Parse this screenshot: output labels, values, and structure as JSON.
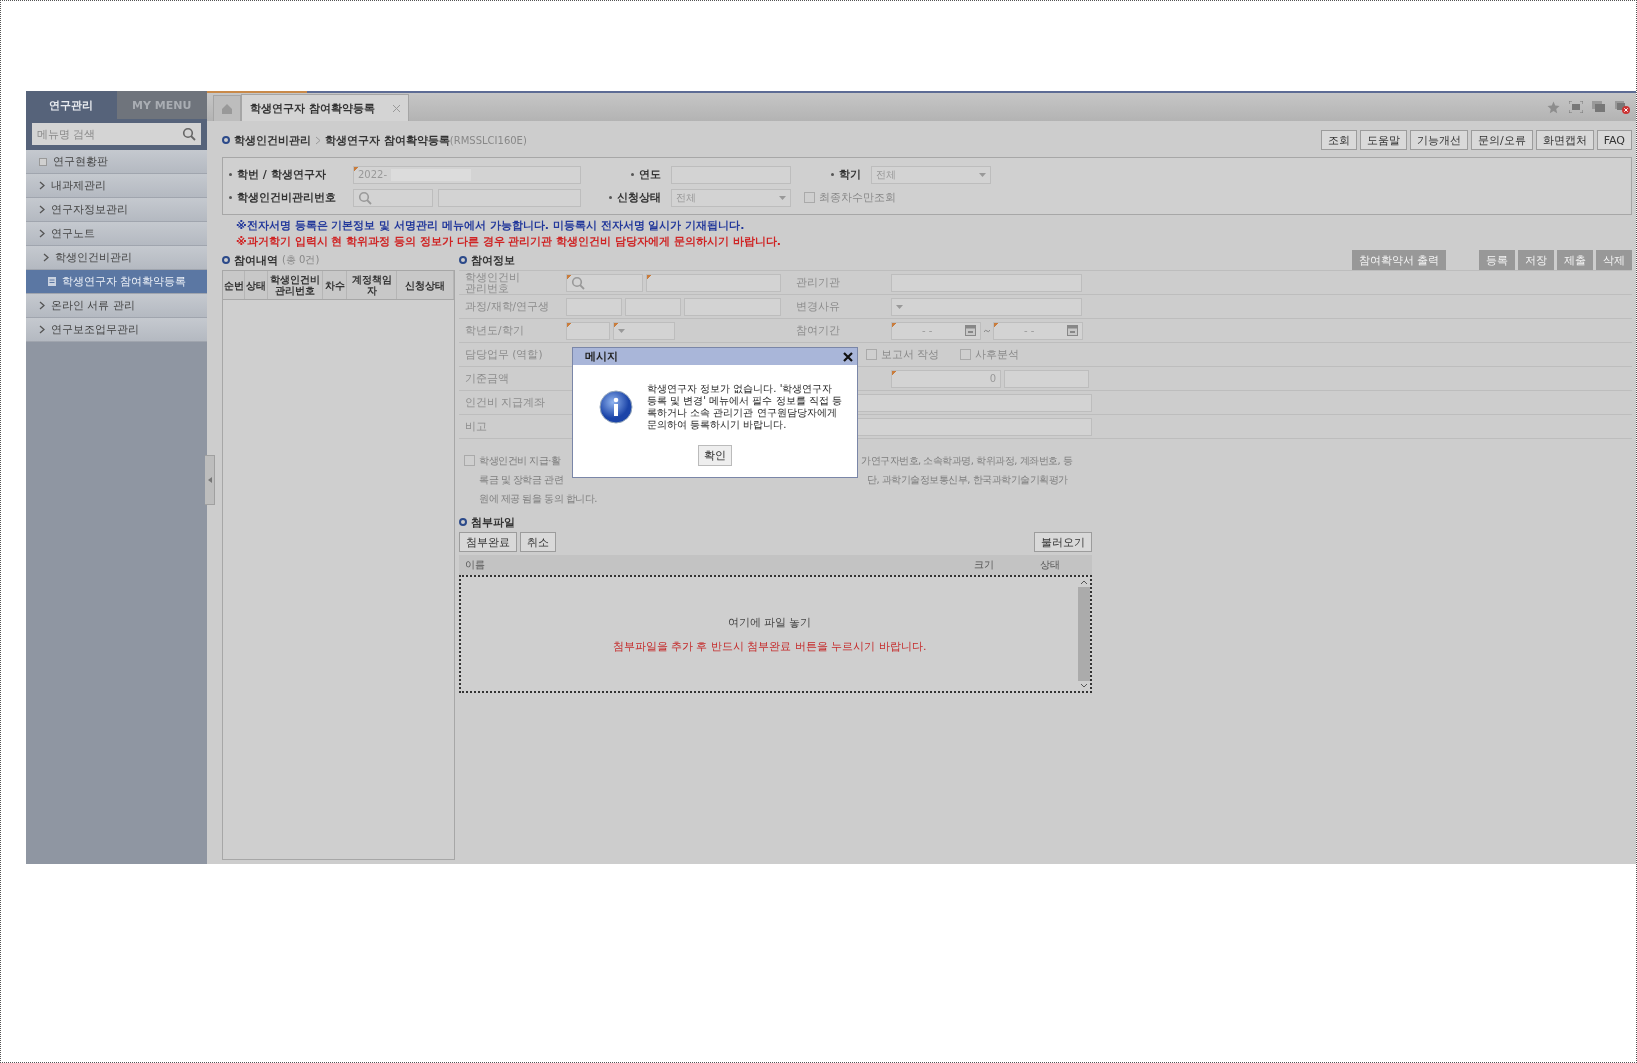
{
  "sidebar": {
    "tabs": [
      {
        "label": "연구관리",
        "selected": true
      },
      {
        "label": "MY MENU",
        "selected": false
      }
    ],
    "search": {
      "placeholder": "메뉴명 검색"
    },
    "items": [
      {
        "label": "연구현황판",
        "kind": "board",
        "selected": false
      },
      {
        "label": "내과제관리",
        "kind": "folder",
        "selected": false
      },
      {
        "label": "연구자정보관리",
        "kind": "folder",
        "selected": false
      },
      {
        "label": "연구노트",
        "kind": "folder",
        "selected": false
      },
      {
        "label": "학생인건비관리",
        "kind": "folder",
        "selected": false,
        "children": [
          {
            "label": "학생연구자 참여확약등록",
            "kind": "page",
            "selected": true
          }
        ]
      },
      {
        "label": "온라인 서류 관리",
        "kind": "folder",
        "selected": false
      },
      {
        "label": "연구보조업무관리",
        "kind": "folder",
        "selected": false
      }
    ]
  },
  "tabs": [
    {
      "label": "학생연구자 참여확약등록",
      "selected": true
    }
  ],
  "breadcrumb": [
    "학생인건비관리",
    "학생연구자 참여확약등록"
  ],
  "screen_code": "(RMSSLCI160E)",
  "toolbar_buttons": [
    "조회",
    "도움말",
    "기능개선",
    "문의/오류",
    "화면캡처",
    "FAQ"
  ],
  "search_form": {
    "student": {
      "label": "학번 / 학생연구자",
      "value": "2022-"
    },
    "year": {
      "label": "연도"
    },
    "semester": {
      "label": "학기",
      "value": "전체"
    },
    "management_no": {
      "label": "학생인건비관리번호"
    },
    "status": {
      "label": "신청상태",
      "value": "전체"
    },
    "final_only": {
      "label": "최종차수만조회",
      "checked": false
    }
  },
  "notices": [
    {
      "kind": "info",
      "text": "※전자서명 등록은 기본정보 및 서명관리 메뉴에서 가능합니다. 미등록시 전자서명 일시가 기재됩니다."
    },
    {
      "kind": "warning",
      "text": "※과거학기 입력시 현 학위과정 등의 정보가 다른 경우 관리기관 학생인건비 담당자에게 문의하시기 바랍니다."
    }
  ],
  "history": {
    "title": "참여내역",
    "count": "(총 0건)",
    "columns": [
      "순번",
      "상태",
      "학생인건비 관리번호",
      "차수",
      "계정책임자",
      "신청상태"
    ]
  },
  "participation": {
    "title": "참여정보",
    "buttons": [
      {
        "label": "참여확약서 출력",
        "disabled": true
      },
      {
        "label": "등록",
        "disabled": true
      },
      {
        "label": "저장",
        "disabled": true
      },
      {
        "label": "제출",
        "disabled": true
      },
      {
        "label": "삭제",
        "disabled": true
      }
    ],
    "labels": [
      "학생인건비 관리번호",
      "과정/재학/연구생",
      "학년도/학기",
      "담당업무 (역할)",
      "기준금액",
      "인건비 지급계좌",
      "비고"
    ],
    "right_labels": [
      "관리기관",
      "변경사유",
      "참여기간"
    ],
    "period": {
      "start_placeholder": "- -",
      "end_placeholder": "- -"
    },
    "roles": [
      {
        "label": "보고서 작성",
        "checked": false
      },
      {
        "label": "사후분석",
        "checked": false
      }
    ],
    "amount": "0",
    "consent": {
      "checked": false,
      "lines": [
        {
          "left": "학생인건비 지급·활",
          "right": "가연구자번호, 소속학과명, 학위과정, 계좌번호, 등"
        },
        {
          "left": "록금 및 장학금 관련",
          "right": "단, 과학기술정보통신부, 한국과학기술기획평가"
        },
        {
          "left": "원에 제공 됨을 동의 합니다."
        }
      ]
    }
  },
  "attachments": {
    "title": "첨부파일",
    "buttons": [
      "첨부완료",
      "취소"
    ],
    "load_button": "불러오기",
    "columns": [
      "이름",
      "크기",
      "상태"
    ],
    "drop_hint": "여기에 파일 놓기",
    "warning": "첨부파일을 추가 후 반드시 첨부완료 버튼을 누르시기 바랍니다."
  },
  "dialog": {
    "title": "메시지",
    "message": "학생연구자 정보가 없습니다. '학생연구자 등록 및 변경' 메뉴에서 필수 정보를 직접 등록하거나 소속 관리기관 연구원담당자에게 문의하여 등록하시기 바랍니다.",
    "button": "확인"
  }
}
